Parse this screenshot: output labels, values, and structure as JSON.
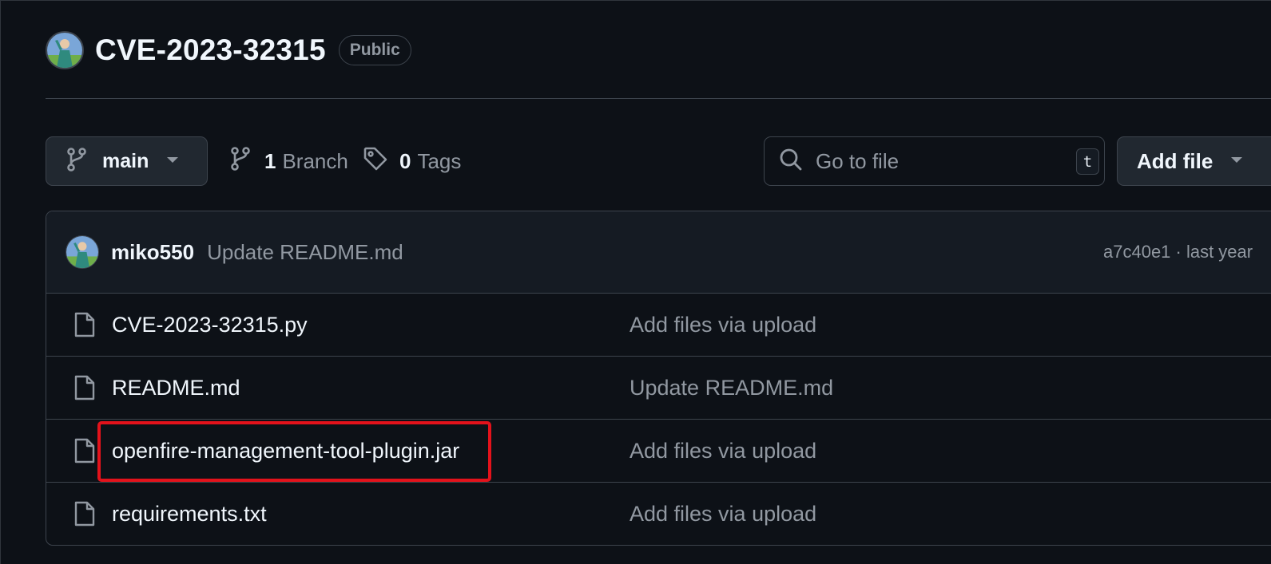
{
  "repo": {
    "name": "CVE-2023-32315",
    "visibility": "Public"
  },
  "toolbar": {
    "branch_name": "main",
    "branch_count": "1",
    "branch_label": "Branch",
    "tag_count": "0",
    "tag_label": "Tags",
    "search_placeholder": "Go to file",
    "search_shortcut": "t",
    "add_file_label": "Add file"
  },
  "latest_commit": {
    "author": "miko550",
    "message": "Update README.md",
    "meta": "a7c40e1 · last year"
  },
  "files": [
    {
      "name": "CVE-2023-32315.py",
      "commit_message": "Add files via upload"
    },
    {
      "name": "README.md",
      "commit_message": "Update README.md"
    },
    {
      "name": "openfire-management-tool-plugin.jar",
      "commit_message": "Add files via upload"
    },
    {
      "name": "requirements.txt",
      "commit_message": "Add files via upload"
    }
  ],
  "colors": {
    "background": "#0d1117",
    "border": "#3d444d",
    "muted_text": "#9198a1",
    "highlight": "#e3121b"
  }
}
